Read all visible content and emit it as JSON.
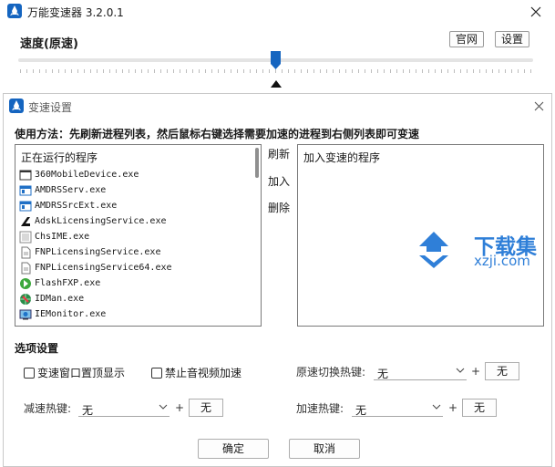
{
  "main_window": {
    "title": "万能变速器 3.2.0.1",
    "speed_label": "速度(原速)",
    "official_site_label": "官网",
    "settings_label": "设置",
    "slider": {
      "level_fraction": 0.5
    }
  },
  "dialog": {
    "title": "变速设置",
    "usage_text": "使用方法：先刷新进程列表，然后鼠标右键选择需要加速的进程到右侧列表即可变速",
    "running_header": "正在运行的程序",
    "processes": [
      {
        "name": "360MobileDevice.exe",
        "icon": "window-icon"
      },
      {
        "name": "AMDRSServ.exe",
        "icon": "amd-window-icon"
      },
      {
        "name": "AMDRSSrcExt.exe",
        "icon": "amd-window-icon"
      },
      {
        "name": "AdskLicensingService.exe",
        "icon": "autodesk-icon"
      },
      {
        "name": "ChsIME.exe",
        "icon": "ime-icon"
      },
      {
        "name": "FNPLicensingService.exe",
        "icon": "document-icon"
      },
      {
        "name": "FNPLicensingService64.exe",
        "icon": "document-icon"
      },
      {
        "name": "FlashFXP.exe",
        "icon": "flashfxp-icon"
      },
      {
        "name": "IDMan.exe",
        "icon": "idm-globe-icon"
      },
      {
        "name": "IEMonitor.exe",
        "icon": "ie-monitor-icon"
      }
    ],
    "refresh_label": "刷新",
    "add_label": "加入",
    "delete_label": "删除",
    "speed_list_header": "加入变速的程序",
    "options_title": "选项设置",
    "topmost_label": "变速窗口置顶显示",
    "disable_av_label": "禁止音视频加速",
    "toggle_hotkey_label": "原速切换热键:",
    "toggle_hotkey_value": "无",
    "toggle_hotkey_key": "无",
    "slow_hotkey_label": "减速热键:",
    "slow_hotkey_value": "无",
    "slow_hotkey_key": "无",
    "fast_hotkey_label": "加速热键:",
    "fast_hotkey_value": "无",
    "fast_hotkey_key": "无",
    "plus": "+",
    "ok_label": "确定",
    "cancel_label": "取消"
  },
  "watermark": {
    "cn": "下载集",
    "en": "xzji.com"
  },
  "colors": {
    "accent": "#1565c0",
    "watermark": "#2f7fd8",
    "border": "#7a7a7a"
  }
}
